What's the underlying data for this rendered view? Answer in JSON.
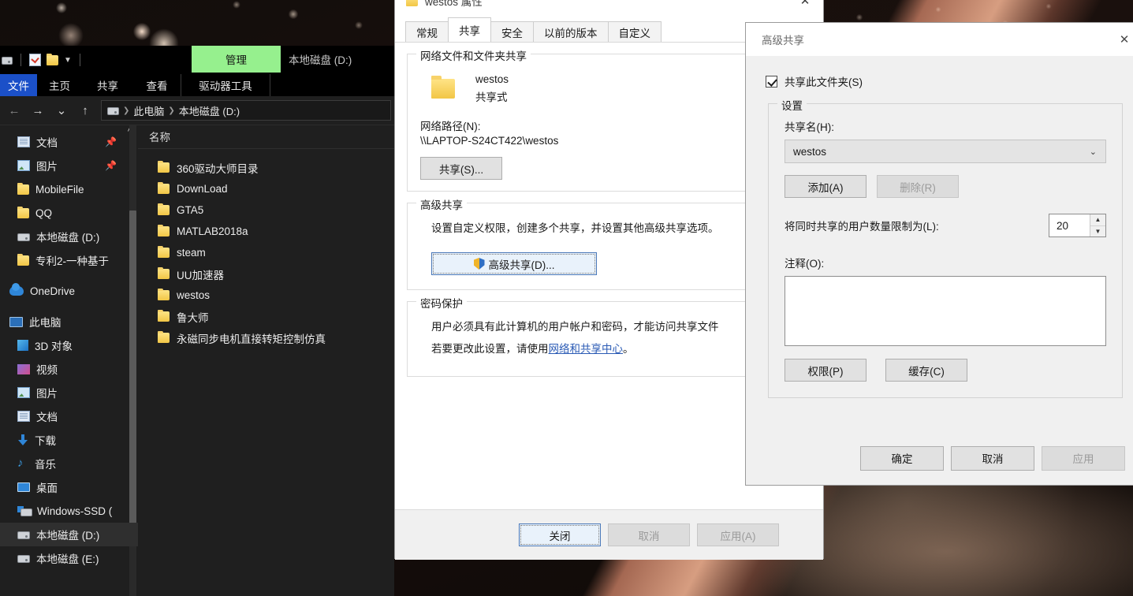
{
  "explorer": {
    "quick_access": {
      "drive_label": "本地磁盘 (D:)",
      "manage_tab": "管理",
      "icons": [
        "checklist-icon",
        "folder-icon",
        "chevron-down-icon"
      ]
    },
    "ribbon_tabs": [
      {
        "label": "文件",
        "name": "tab-file"
      },
      {
        "label": "主页",
        "name": "tab-home"
      },
      {
        "label": "共享",
        "name": "tab-share"
      },
      {
        "label": "查看",
        "name": "tab-view"
      },
      {
        "label": "驱动器工具",
        "name": "tab-drive-tools"
      }
    ],
    "nav": {
      "back": "←",
      "forward": "→",
      "recent": "⌄",
      "up": "↑"
    },
    "breadcrumb": [
      "此电脑",
      "本地磁盘 (D:)"
    ],
    "sidebar": [
      {
        "label": "文档",
        "icon": "document-icon",
        "pinned": true,
        "indent": true
      },
      {
        "label": "图片",
        "icon": "picture-icon",
        "pinned": true,
        "indent": true
      },
      {
        "label": "MobileFile",
        "icon": "folder-icon",
        "indent": true
      },
      {
        "label": "QQ",
        "icon": "folder-icon",
        "indent": true
      },
      {
        "label": "本地磁盘 (D:)",
        "icon": "drive-icon",
        "indent": true
      },
      {
        "label": "专利2-一种基于",
        "icon": "folder-icon",
        "indent": true
      },
      {
        "label": "OneDrive",
        "icon": "onedrive-icon"
      },
      {
        "label": "此电脑",
        "icon": "this-pc-icon"
      },
      {
        "label": "3D 对象",
        "icon": "3d-objects-icon",
        "indent": true
      },
      {
        "label": "视频",
        "icon": "videos-icon",
        "indent": true
      },
      {
        "label": "图片",
        "icon": "picture-icon",
        "indent": true
      },
      {
        "label": "文档",
        "icon": "document-icon",
        "indent": true
      },
      {
        "label": "下载",
        "icon": "downloads-icon",
        "indent": true
      },
      {
        "label": "音乐",
        "icon": "music-icon",
        "indent": true
      },
      {
        "label": "桌面",
        "icon": "desktop-icon",
        "indent": true
      },
      {
        "label": "Windows-SSD (",
        "icon": "windows-drive-icon",
        "indent": true
      },
      {
        "label": "本地磁盘 (D:)",
        "icon": "drive-icon",
        "indent": true,
        "selected": true
      },
      {
        "label": "本地磁盘 (E:)",
        "icon": "drive-icon",
        "indent": true
      }
    ],
    "column_header": "名称",
    "files": [
      "360驱动大师目录",
      "DownLoad",
      "GTA5",
      "MATLAB2018a",
      "steam",
      "UU加速器",
      "westos",
      "鲁大师",
      "永磁同步电机直接转矩控制仿真"
    ]
  },
  "properties_dialog": {
    "title": "westos 属性",
    "close_label": "✕",
    "tabs": [
      {
        "label": "常规",
        "active": false
      },
      {
        "label": "共享",
        "active": true
      },
      {
        "label": "安全",
        "active": false
      },
      {
        "label": "以前的版本",
        "active": false
      },
      {
        "label": "自定义",
        "active": false
      }
    ],
    "network_share_group": {
      "legend": "网络文件和文件夹共享",
      "folder_name": "westos",
      "share_state": "共享式",
      "path_label": "网络路径(N):",
      "path_value": "\\\\LAPTOP-S24CT422\\westos",
      "share_button": "共享(S)..."
    },
    "advanced_share_group": {
      "legend": "高级共享",
      "description": "设置自定义权限，创建多个共享，并设置其他高级共享选项。",
      "button": "高级共享(D)...",
      "button_icon": "shield-icon"
    },
    "password_group": {
      "legend": "密码保护",
      "line1": "用户必须具有此计算机的用户帐户和密码，才能访问共享文件",
      "line2_prefix": "若要更改此设置，请使用",
      "line2_link": "网络和共享中心",
      "line2_suffix": "。"
    },
    "footer": {
      "close": "关闭",
      "cancel": "取消",
      "apply": "应用(A)"
    }
  },
  "advanced_sharing_dialog": {
    "title": "高级共享",
    "close_label": "✕",
    "share_checkbox": {
      "label": "共享此文件夹(S)",
      "checked": true
    },
    "settings_group": {
      "legend": "设置",
      "share_name_label": "共享名(H):",
      "share_name_value": "westos",
      "add_button": "添加(A)",
      "remove_button": "删除(R)",
      "limit_label": "将同时共享的用户数量限制为(L):",
      "limit_value": "20",
      "spinner_up": "▲",
      "spinner_down": "▼",
      "comment_label": "注释(O):",
      "comment_value": "",
      "permissions_button": "权限(P)",
      "cache_button": "缓存(C)"
    },
    "footer": {
      "ok": "确定",
      "cancel": "取消",
      "apply": "应用"
    }
  },
  "colors": {
    "manage_tab_green": "#96f08e",
    "file_tab_blue": "#1b50c8",
    "link_blue": "#2b5bb5",
    "focus_blue": "#4a78b8"
  }
}
